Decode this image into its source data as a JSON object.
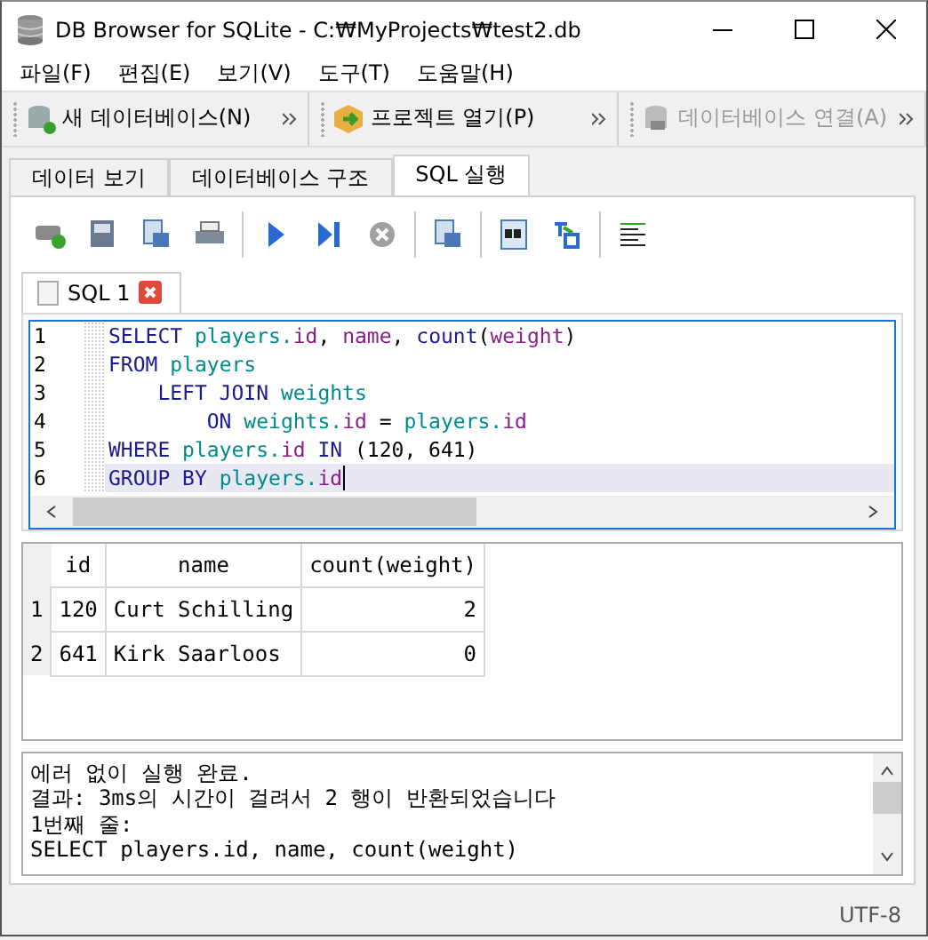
{
  "window": {
    "title": "DB Browser for SQLite - C:₩MyProjects₩test2.db"
  },
  "menu": [
    "파일(F)",
    "편집(E)",
    "보기(V)",
    "도구(T)",
    "도움말(H)"
  ],
  "toolbar": [
    {
      "label": "새 데이터베이스(N)",
      "disabled": false
    },
    {
      "label": "프로젝트 열기(P)",
      "disabled": false
    },
    {
      "label": "데이터베이스 연결(A)",
      "disabled": true
    }
  ],
  "tabs": [
    {
      "label": "데이터 보기",
      "selected": false
    },
    {
      "label": "데이터베이스 구조",
      "selected": false
    },
    {
      "label": "SQL 실행",
      "selected": true
    }
  ],
  "editor_tabs": [
    {
      "label": "SQL 1",
      "selected": true
    }
  ],
  "editor": {
    "lines": [
      {
        "number": "1",
        "current": false,
        "tokens": [
          {
            "text": "SELECT ",
            "kind": "keyword"
          },
          {
            "text": "players.",
            "kind": "table"
          },
          {
            "text": "id",
            "kind": "column"
          },
          {
            "text": ", ",
            "kind": "plain"
          },
          {
            "text": "name",
            "kind": "column"
          },
          {
            "text": ", ",
            "kind": "plain"
          },
          {
            "text": "count",
            "kind": "keyword"
          },
          {
            "text": "(",
            "kind": "plain"
          },
          {
            "text": "weight",
            "kind": "column"
          },
          {
            "text": ")",
            "kind": "plain"
          }
        ]
      },
      {
        "number": "2",
        "current": false,
        "tokens": [
          {
            "text": "FROM ",
            "kind": "keyword"
          },
          {
            "text": "players",
            "kind": "table"
          }
        ]
      },
      {
        "number": "3",
        "current": false,
        "tokens": [
          {
            "text": "    LEFT JOIN ",
            "kind": "keyword"
          },
          {
            "text": "weights",
            "kind": "table"
          }
        ]
      },
      {
        "number": "4",
        "current": false,
        "tokens": [
          {
            "text": "        ON ",
            "kind": "keyword"
          },
          {
            "text": "weights.",
            "kind": "table"
          },
          {
            "text": "id",
            "kind": "column"
          },
          {
            "text": " = ",
            "kind": "plain"
          },
          {
            "text": "players.",
            "kind": "table"
          },
          {
            "text": "id",
            "kind": "column"
          }
        ]
      },
      {
        "number": "5",
        "current": false,
        "tokens": [
          {
            "text": "WHERE ",
            "kind": "keyword"
          },
          {
            "text": "players.",
            "kind": "table"
          },
          {
            "text": "id",
            "kind": "column"
          },
          {
            "text": " IN ",
            "kind": "keyword"
          },
          {
            "text": "(120, 641)",
            "kind": "plain"
          }
        ]
      },
      {
        "number": "6",
        "current": true,
        "tokens": [
          {
            "text": "GROUP BY ",
            "kind": "keyword"
          },
          {
            "text": "players.",
            "kind": "table"
          },
          {
            "text": "id",
            "kind": "column"
          }
        ]
      }
    ]
  },
  "results": {
    "columns": [
      "id",
      "name",
      "count(weight)"
    ],
    "rows": [
      {
        "number": "1",
        "cells": [
          "120",
          "Curt Schilling",
          "2"
        ]
      },
      {
        "number": "2",
        "cells": [
          "641",
          "Kirk Saarloos",
          "0"
        ]
      }
    ]
  },
  "messages": [
    "에러 없이 실행 완료.",
    "결과: 3ms의 시간이 걸려서 2 행이 반환되었습니다",
    "1번째 줄:",
    "SELECT players.id, name, count(weight)"
  ],
  "status_bar": {
    "encoding": "UTF-8"
  }
}
